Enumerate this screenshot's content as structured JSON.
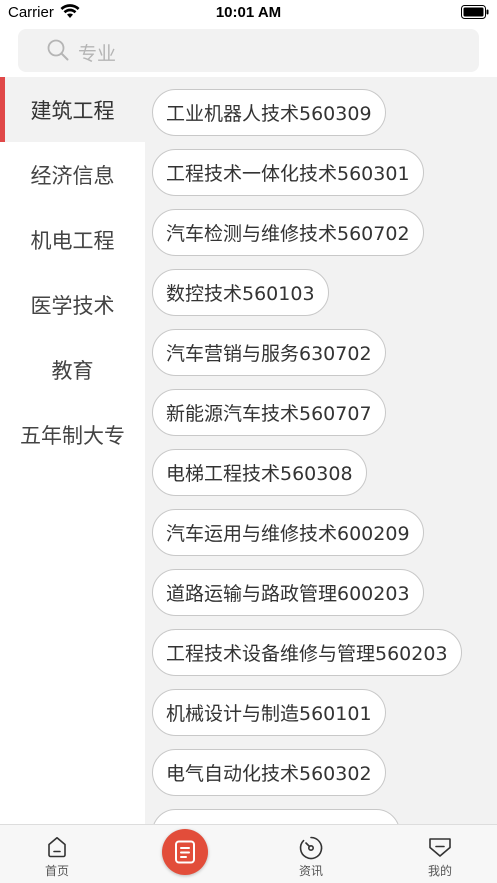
{
  "status_bar": {
    "carrier": "Carrier",
    "time": "10:01 AM"
  },
  "search": {
    "placeholder": "专业"
  },
  "sidebar": {
    "active_color": "#e04848",
    "items": [
      {
        "label": "建筑工程",
        "active": true
      },
      {
        "label": "经济信息",
        "active": false
      },
      {
        "label": "机电工程",
        "active": false
      },
      {
        "label": "医学技术",
        "active": false
      },
      {
        "label": "教育",
        "active": false
      },
      {
        "label": "五年制大专",
        "active": false
      }
    ]
  },
  "majors": [
    "工业机器人技术560309",
    "工程技术一体化技术560301",
    "汽车检测与维修技术560702",
    "数控技术560103",
    "汽车营销与服务630702",
    "新能源汽车技术560707",
    "电梯工程技术560308",
    "汽车运用与维修技术600209",
    "道路运输与路政管理600203",
    "工程技术设备维修与管理560203",
    "机械设计与制造560101",
    "电气自动化技术560302",
    ""
  ],
  "tabbar": {
    "center_color": "#e24d3a",
    "tabs": [
      {
        "label": "首页",
        "icon": "home-icon"
      },
      {
        "label": "",
        "icon": "document-icon"
      },
      {
        "label": "资讯",
        "icon": "compass-icon"
      },
      {
        "label": "我的",
        "icon": "user-icon"
      }
    ]
  }
}
